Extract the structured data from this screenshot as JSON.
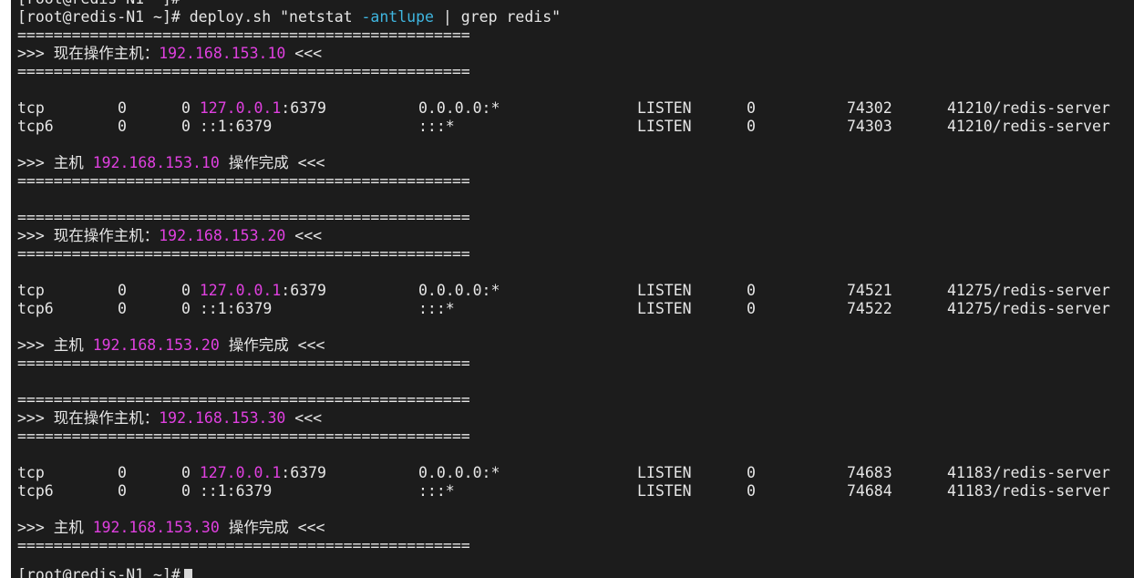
{
  "prompt": "[root@redis-N1 ~]#",
  "command": {
    "pre": " deploy.sh \"netstat ",
    "opt": "-antlupe",
    "post": " | grep redis\""
  },
  "separator": "==================================================",
  "sections": [
    {
      "host": "192.168.153.10",
      "rows": [
        {
          "proto": "tcp",
          "recvq": "0",
          "sendq": "0",
          "local_ip": "127.0.0.1",
          "local_port": ":6379",
          "foreign": "0.0.0.0:*",
          "state": "LISTEN",
          "user": "0",
          "inode": "74302",
          "program": "41210/redis-server"
        },
        {
          "proto": "tcp6",
          "recvq": "0",
          "sendq": "0",
          "local_ip": "",
          "local_port": "::1:6379",
          "foreign": ":::*",
          "state": "LISTEN",
          "user": "0",
          "inode": "74303",
          "program": "41210/redis-server"
        }
      ]
    },
    {
      "host": "192.168.153.20",
      "rows": [
        {
          "proto": "tcp",
          "recvq": "0",
          "sendq": "0",
          "local_ip": "127.0.0.1",
          "local_port": ":6379",
          "foreign": "0.0.0.0:*",
          "state": "LISTEN",
          "user": "0",
          "inode": "74521",
          "program": "41275/redis-server"
        },
        {
          "proto": "tcp6",
          "recvq": "0",
          "sendq": "0",
          "local_ip": "",
          "local_port": "::1:6379",
          "foreign": ":::*",
          "state": "LISTEN",
          "user": "0",
          "inode": "74522",
          "program": "41275/redis-server"
        }
      ]
    },
    {
      "host": "192.168.153.30",
      "rows": [
        {
          "proto": "tcp",
          "recvq": "0",
          "sendq": "0",
          "local_ip": "127.0.0.1",
          "local_port": ":6379",
          "foreign": "0.0.0.0:*",
          "state": "LISTEN",
          "user": "0",
          "inode": "74683",
          "program": "41183/redis-server"
        },
        {
          "proto": "tcp6",
          "recvq": "0",
          "sendq": "0",
          "local_ip": "",
          "local_port": "::1:6379",
          "foreign": ":::*",
          "state": "LISTEN",
          "user": "0",
          "inode": "74684",
          "program": "41183/redis-server"
        }
      ]
    }
  ],
  "labels": {
    "arrow_in": ">>> ",
    "arrow_out": " <<<",
    "operating_prefix": "现在操作主机：",
    "host_prefix": "主机 ",
    "done_suffix": " 操作完成"
  },
  "colors": {
    "background": "#1c1c1c",
    "text": "#e6e6e6",
    "ip_highlight": "#e040e0",
    "option_highlight": "#3fb6e0"
  }
}
